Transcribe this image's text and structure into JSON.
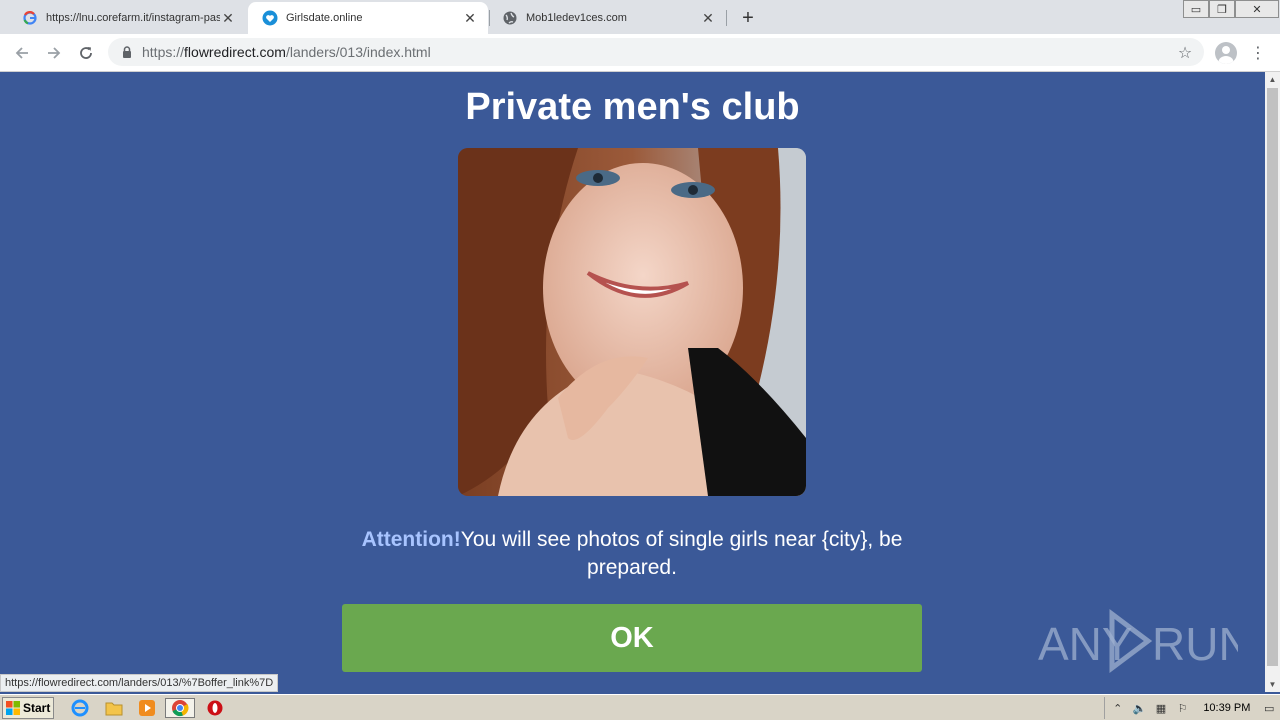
{
  "browser": {
    "tabs": [
      {
        "title": "https://lnu.corefarm.it/instagram-pas",
        "favicon": "google-g-icon",
        "active": false
      },
      {
        "title": "Girlsdate.online",
        "favicon": "heart-shield-icon",
        "active": true
      },
      {
        "title": "Mob1ledev1ces.com",
        "favicon": "globe-icon",
        "active": false
      }
    ],
    "url": {
      "scheme": "https://",
      "host": "flowredirect.com",
      "path": "/landers/013/index.html"
    },
    "status_url": "https://flowredirect.com/landers/013/%7Boffer_link%7D"
  },
  "page": {
    "heading": "Private men's club",
    "photo_alt": "portrait photo",
    "message_attention": "Attention!",
    "message_body": "You will see photos of single girls near {city}, be prepared.",
    "ok_label": "OK",
    "watermark": "ANY RUN"
  },
  "taskbar": {
    "start_label": "Start",
    "clock": "10:39 PM"
  },
  "colors": {
    "page_bg": "#3b5998",
    "ok_button": "#6aa84f",
    "attention": "#a8c4ff"
  }
}
